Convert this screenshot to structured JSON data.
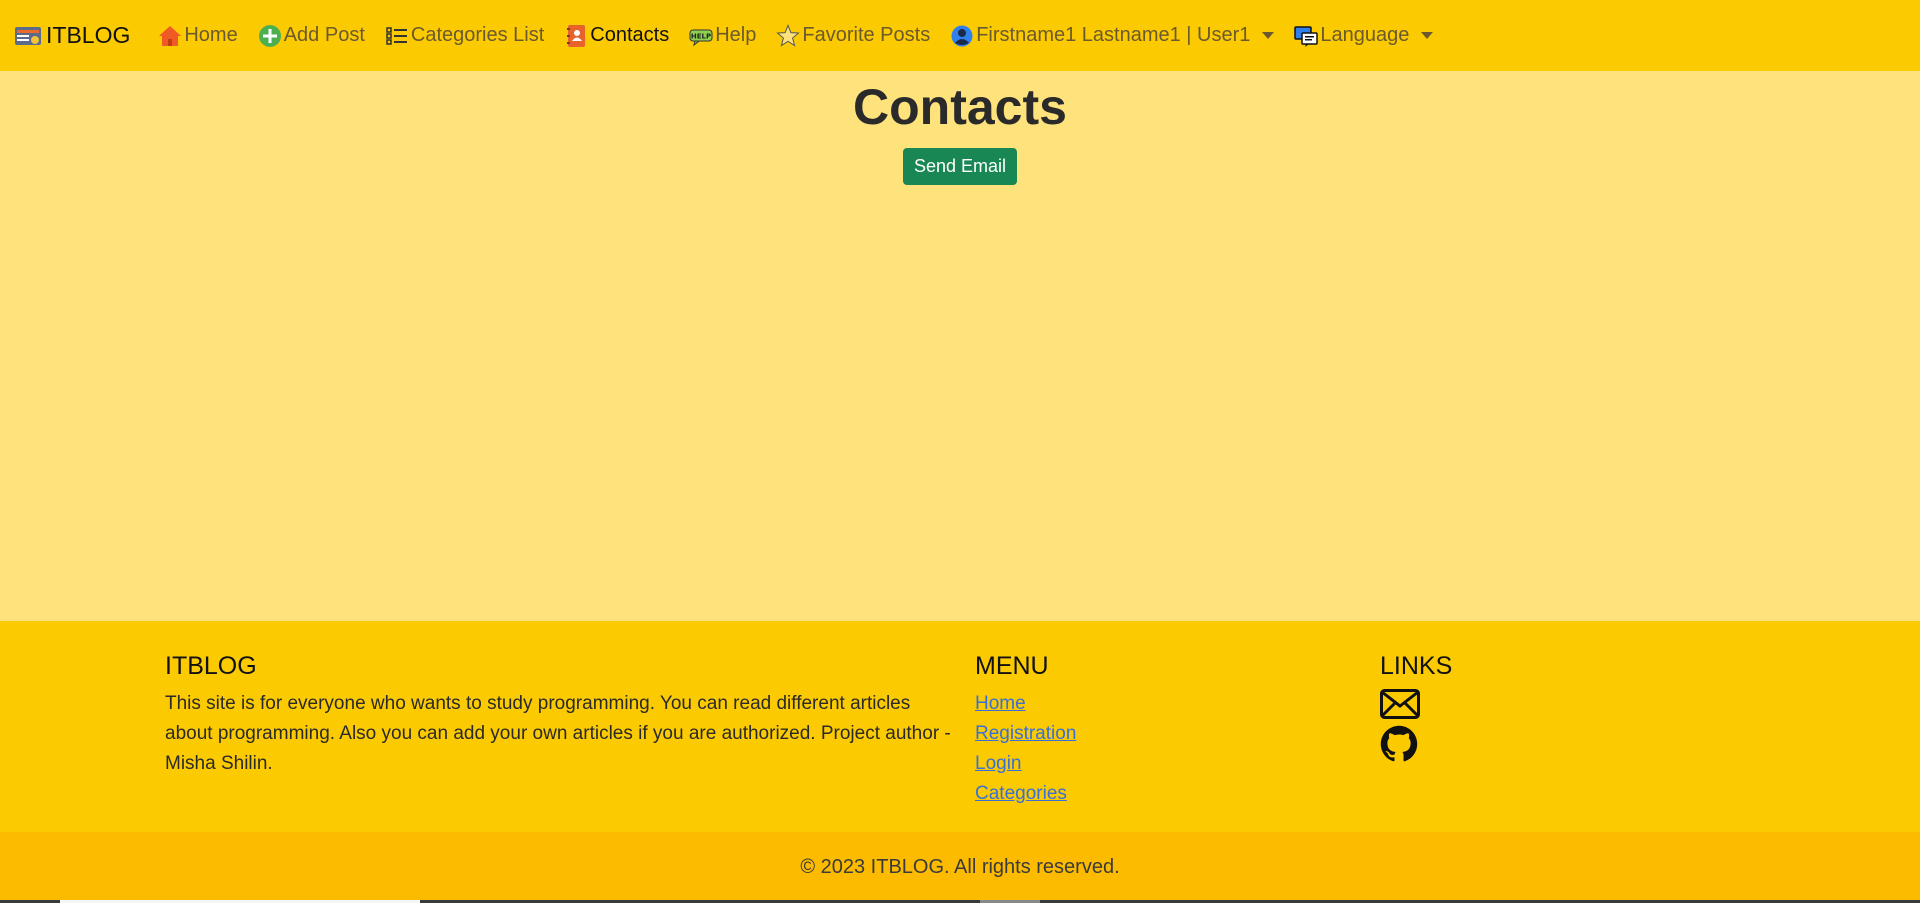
{
  "navbar": {
    "brand": "ITBLOG",
    "items": [
      {
        "label": "Home",
        "icon": "home-icon"
      },
      {
        "label": "Add Post",
        "icon": "add-icon"
      },
      {
        "label": "Categories List",
        "icon": "list-icon"
      },
      {
        "label": "Contacts",
        "icon": "contacts-icon",
        "active": true
      },
      {
        "label": "Help",
        "icon": "help-icon"
      },
      {
        "label": "Favorite Posts",
        "icon": "star-icon"
      },
      {
        "label": "Firstname1 Lastname1 | User1",
        "icon": "user-icon"
      },
      {
        "label": "Language",
        "icon": "language-icon"
      }
    ]
  },
  "main": {
    "title": "Contacts",
    "send_email_label": "Send Email"
  },
  "footer": {
    "about_title": "ITBLOG",
    "about_text": "This site is for everyone who wants to study programming. You can read different articles about programming. Also you can add your own articles if you are authorized. Project author - Misha Shilin.",
    "menu_title": "MENU",
    "menu_links": [
      "Home",
      "Registration",
      "Login",
      "Categories"
    ],
    "links_title": "LINKS",
    "links": [
      "envelope-icon",
      "github-icon"
    ]
  },
  "copyright": "© 2023 ITBLOG. All rights reserved.",
  "colors": {
    "navbar": "#fcca00",
    "page_background": "#fee27b",
    "footer": "#fcca00",
    "copyright_bar": "#fdbb00",
    "send_button": "#198754",
    "link": "#3a6fd8"
  }
}
